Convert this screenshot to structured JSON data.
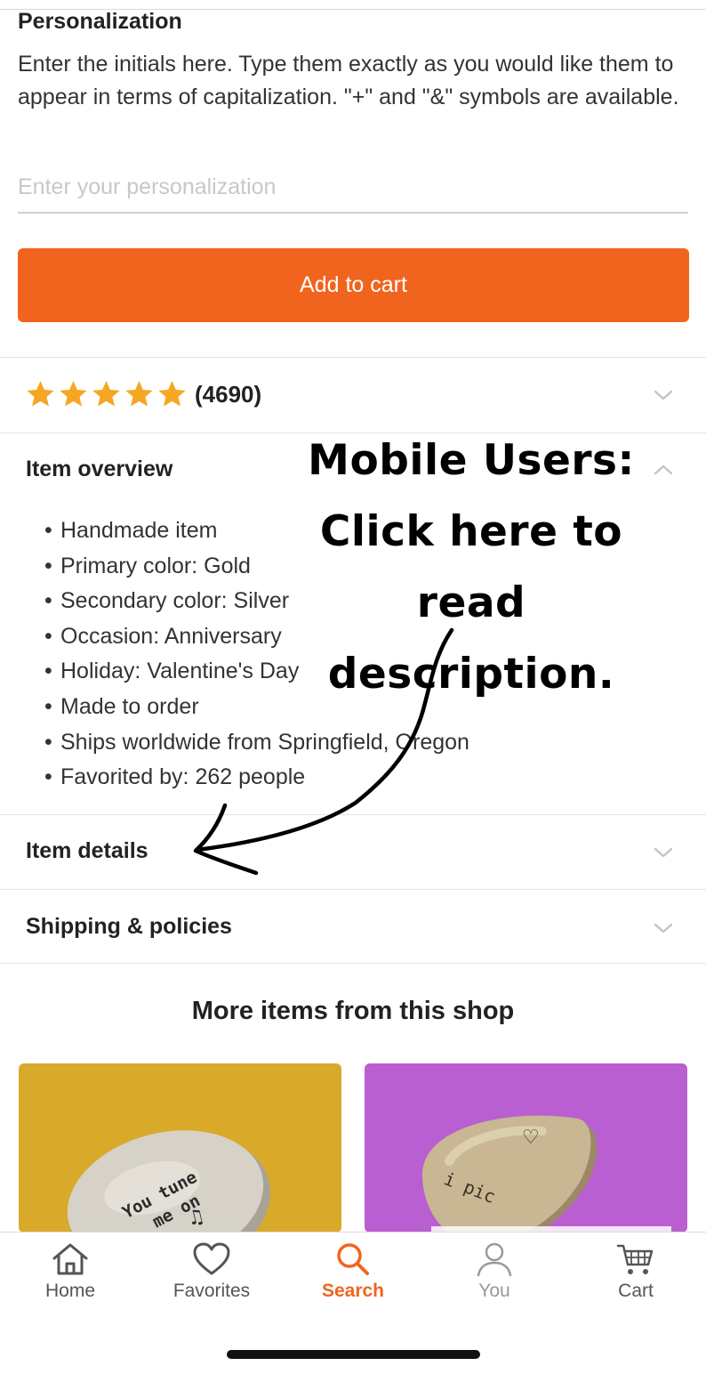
{
  "personalization": {
    "title": "Personalization",
    "description": "Enter the initials here. Type them exactly as you would like them to appear in terms of capitalization. \"+\" and \"&\" symbols are available.",
    "placeholder": "Enter your personalization",
    "value": ""
  },
  "add_to_cart_label": "Add to cart",
  "reviews": {
    "stars": 5,
    "count_text": "(4690)"
  },
  "item_overview": {
    "title": "Item overview",
    "items": [
      "Handmade item",
      "Primary color: Gold",
      "Secondary color: Silver",
      "Occasion: Anniversary",
      "Holiday: Valentine's Day",
      "Made to order",
      "Ships worldwide from Springfield, Oregon",
      "Favorited by: 262 people"
    ]
  },
  "item_details_title": "Item details",
  "shipping_title": "Shipping & policies",
  "more_items_title": "More items from this shop",
  "annotation": {
    "line1": "Mobile Users:",
    "line2": "Click here to",
    "line3": "read description."
  },
  "cards": [
    {
      "engraving_line1": "You tune",
      "engraving_line2": "me on",
      "engraving_symbol": "♫"
    },
    {
      "engraving_line1": "i pic",
      "engraving_symbol": "♡"
    }
  ],
  "nav": [
    {
      "label": "Home",
      "icon": "home-icon"
    },
    {
      "label": "Favorites",
      "icon": "heart-icon"
    },
    {
      "label": "Search",
      "icon": "search-icon",
      "active": true
    },
    {
      "label": "You",
      "icon": "user-icon"
    },
    {
      "label": "Cart",
      "icon": "cart-icon"
    }
  ],
  "colors": {
    "accent": "#f1641e",
    "star": "#f5a623",
    "text": "#222222"
  }
}
